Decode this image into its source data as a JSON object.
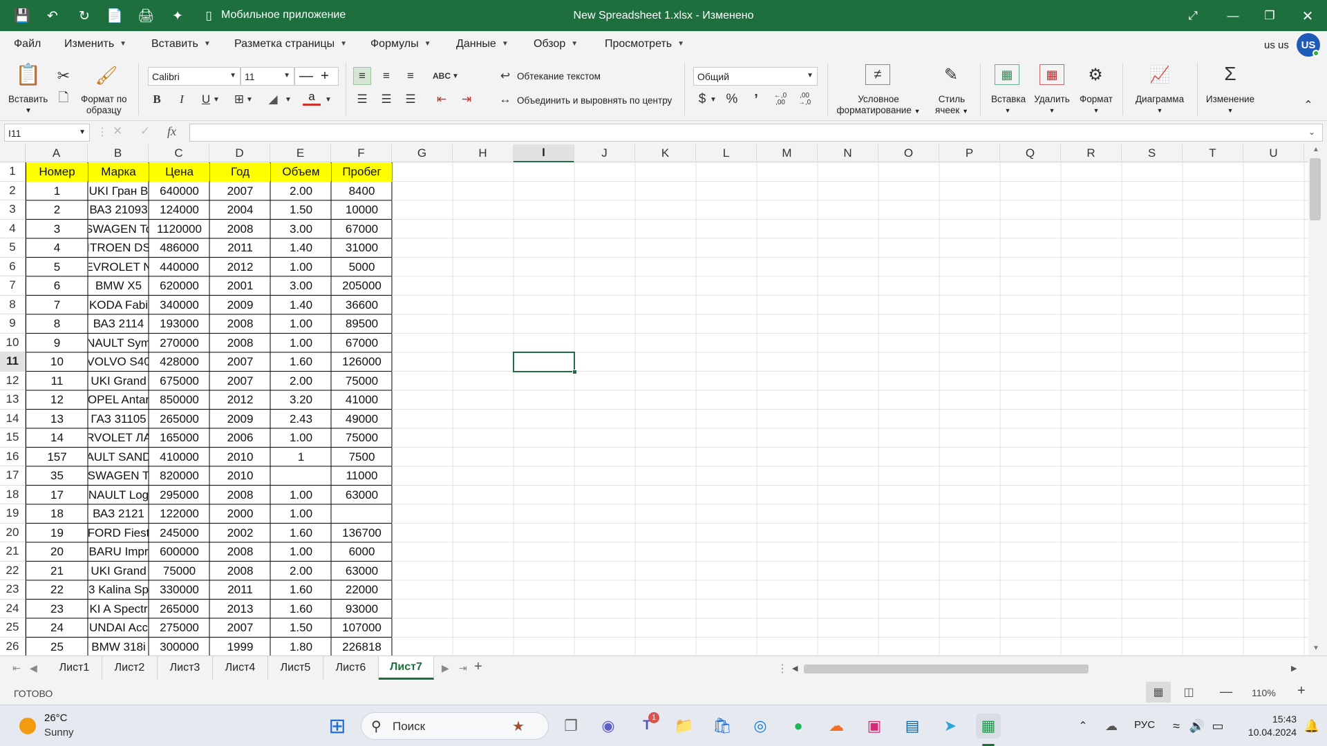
{
  "titlebar": {
    "mobile_app_label": "Мобильное приложение",
    "document_title": "New Spreadsheet 1.xlsx - Изменено",
    "icons": [
      "save-icon",
      "undo-icon",
      "redo-icon",
      "new-document-icon",
      "print-icon",
      "share-icon",
      "phone-icon"
    ]
  },
  "menu": {
    "items": [
      "Файл",
      "Изменить",
      "Вставить",
      "Разметка страницы",
      "Формулы",
      "Данные",
      "Обзор",
      "Просмотреть"
    ],
    "user_name": "us us",
    "avatar_initials": "US"
  },
  "ribbon": {
    "paste": "Вставить",
    "format_painter_line1": "Формат по",
    "format_painter_line2": "образцу",
    "font_name": "Calibri",
    "font_size": "11",
    "wrap_text": "Обтекание текстом",
    "merge_center": "Объединить и выровнять по центру",
    "number_format": "Общий",
    "currency_symbol": "$",
    "percent_symbol": "%",
    "comma_symbol": "’",
    "dec_increase": ",0\n,00",
    "conditional_line1": "Условное",
    "conditional_line2": "форматирование",
    "cell_style_line1": "Стиль",
    "cell_style_line2": "ячеек",
    "insert": "Вставка",
    "delete": "Удалить",
    "format": "Формат",
    "chart": "Диаграмма",
    "edit": "Изменение",
    "bold": "B",
    "italic": "I",
    "underline": "U"
  },
  "formula_bar": {
    "name_box": "I11",
    "fx_label": "fx",
    "formula": ""
  },
  "sheet": {
    "columns": [
      "A",
      "B",
      "C",
      "D",
      "E",
      "F",
      "G",
      "H",
      "I",
      "J",
      "K",
      "L",
      "M",
      "N",
      "O",
      "P",
      "Q",
      "R",
      "S",
      "T",
      "U"
    ],
    "active_column": "I",
    "active_row": 11,
    "header_row": [
      "Номер",
      "Марка",
      "Цена",
      "Год",
      "Объем",
      "Пробег"
    ],
    "rows": [
      [
        "1",
        "UKI Гран В",
        "640000",
        "2007",
        "2.00",
        "8400"
      ],
      [
        "2",
        "ВАЗ 21093",
        "124000",
        "2004",
        "1.50",
        "10000"
      ],
      [
        "3",
        "SWAGEN To",
        "1120000",
        "2008",
        "3.00",
        "67000"
      ],
      [
        "4",
        "ITROEN DS",
        "486000",
        "2011",
        "1.40",
        "31000"
      ],
      [
        "5",
        "EVROLET N",
        "440000",
        "2012",
        "1.00",
        "5000"
      ],
      [
        "6",
        "BMW X5",
        "620000",
        "2001",
        "3.00",
        "205000"
      ],
      [
        "7",
        "KODA Fabi",
        "340000",
        "2009",
        "1.40",
        "36600"
      ],
      [
        "8",
        "ВАЗ 2114",
        "193000",
        "2008",
        "1.00",
        "89500"
      ],
      [
        "9",
        "NAULT Sym",
        "270000",
        "2008",
        "1.00",
        "67000"
      ],
      [
        "10",
        "VOLVO S40",
        "428000",
        "2007",
        "1.60",
        "126000"
      ],
      [
        "11",
        "UKI Grand",
        "675000",
        "2007",
        "2.00",
        "75000"
      ],
      [
        "12",
        "OPEL Antar",
        "850000",
        "2012",
        "3.20",
        "41000"
      ],
      [
        "13",
        "ГАЗ 31105",
        "265000",
        "2009",
        "2.43",
        "49000"
      ],
      [
        "14",
        "RVOLET ЛА",
        "165000",
        "2006",
        "1.00",
        "75000"
      ],
      [
        "157",
        "AULT SAND",
        "410000",
        "2010",
        "1",
        "7500"
      ],
      [
        "35",
        "SWAGEN T",
        "820000",
        "2010",
        "",
        "11000"
      ],
      [
        "17",
        "NAULT Log",
        "295000",
        "2008",
        "1.00",
        "63000"
      ],
      [
        "18",
        "ВАЗ 2121",
        "122000",
        "2000",
        "1.00",
        ""
      ],
      [
        "19",
        "FORD Fiest",
        "245000",
        "2002",
        "1.60",
        "136700"
      ],
      [
        "20",
        "BARU Impr",
        "600000",
        "2008",
        "1.00",
        "6000"
      ],
      [
        "21",
        "UKI Grand",
        "75000",
        "2008",
        "2.00",
        "63000"
      ],
      [
        "22",
        "3 Kalina Sp",
        "330000",
        "2011",
        "1.60",
        "22000"
      ],
      [
        "23",
        "KI A Spectr",
        "265000",
        "2013",
        "1.60",
        "93000"
      ],
      [
        "24",
        "UNDAI Acc",
        "275000",
        "2007",
        "1.50",
        "107000"
      ],
      [
        "25",
        "BMW 318i",
        "300000",
        "1999",
        "1.80",
        "226818"
      ]
    ],
    "header_fill_color": "#ffff00",
    "accent_color": "#1e6f3e"
  },
  "tabs": {
    "items": [
      "Лист1",
      "Лист2",
      "Лист3",
      "Лист4",
      "Лист5",
      "Лист6",
      "Лист7"
    ],
    "active": "Лист7",
    "add_symbol": "+"
  },
  "status": {
    "ready": "ГОТОВО",
    "zoom": "110%"
  },
  "taskbar": {
    "temperature": "26°C",
    "weather": "Sunny",
    "search_placeholder": "Поиск",
    "language": "РУС",
    "time": "15:43",
    "date": "10.04.2024",
    "teams_badge": "1"
  }
}
